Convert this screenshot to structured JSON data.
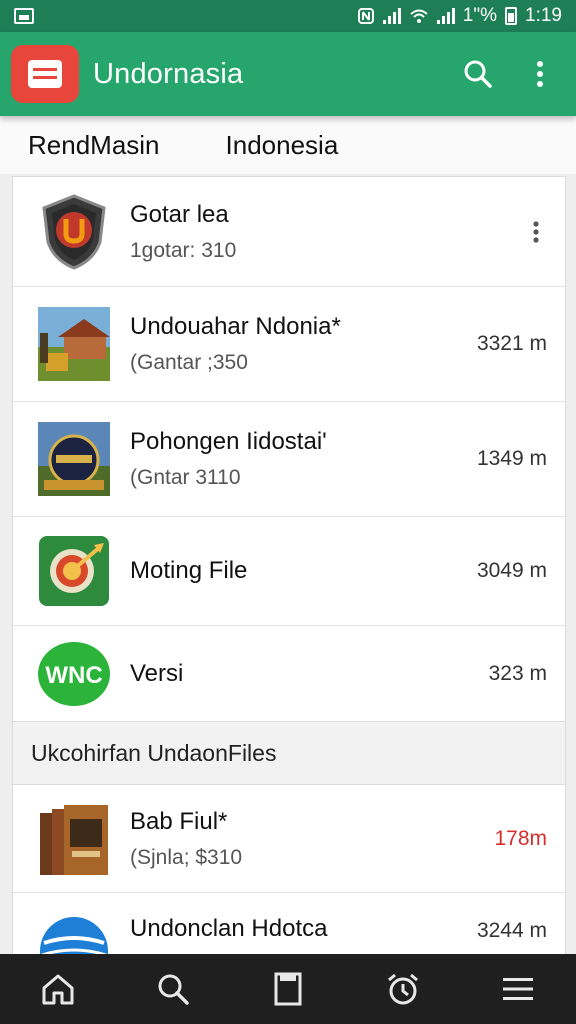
{
  "status_bar": {
    "battery_text": "1\"%",
    "time": "1:19",
    "icons": [
      "screenshot-icon",
      "nfc-icon",
      "signal-icon",
      "wifi-icon",
      "battery-icon"
    ]
  },
  "app_bar": {
    "title": "Undornasia",
    "icons": [
      "menu-icon",
      "search-icon",
      "more-vert-icon"
    ],
    "colors": {
      "bar": "#26a66c",
      "menu_button": "#e8463a",
      "status": "#1e7f57"
    }
  },
  "tabs": [
    {
      "label": "RendMasin"
    },
    {
      "label": "Indonesia"
    }
  ],
  "list": [
    {
      "name": "Gotar lea",
      "sub": "1gotar: 310",
      "size": "",
      "thumb": "shield-logo-icon"
    },
    {
      "name": "Undouahar Ndonia*",
      "sub": "(Gantar ;350",
      "size": "3321 m",
      "thumb": "building-photo-icon"
    },
    {
      "name": "Pohongen Iidostai'",
      "sub": "(Gntar 3110",
      "size": "1349 m",
      "thumb": "badge-photo-icon"
    },
    {
      "name": "Moting File",
      "sub": "",
      "size": "3049 m",
      "thumb": "dart-target-icon"
    },
    {
      "name": "Versi",
      "sub": "",
      "size": "323 m",
      "thumb": "wnc-logo-icon"
    }
  ],
  "section_header": "Ukcohirfan UndaonFiles",
  "list2": [
    {
      "name": "Bab Fiul*",
      "sub": "(Sjnla; $310",
      "size": "178m",
      "size_color": "#d32f2f",
      "thumb": "books-icon"
    },
    {
      "name": "Undonclan Hdotca",
      "sub": "",
      "size": "3244 m",
      "thumb": "globe-icon"
    }
  ],
  "bottom_nav": [
    "home-icon",
    "search-icon",
    "document-icon",
    "alarm-icon",
    "menu-icon"
  ]
}
